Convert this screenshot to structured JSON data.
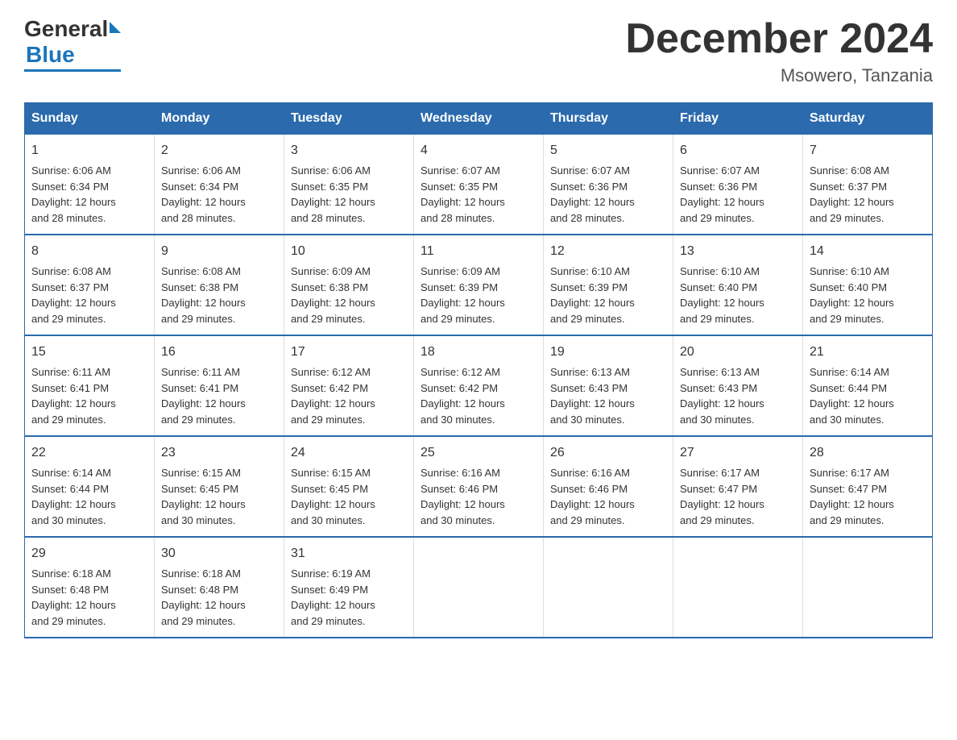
{
  "logo": {
    "general": "General",
    "blue": "Blue"
  },
  "title": "December 2024",
  "location": "Msowero, Tanzania",
  "days_of_week": [
    "Sunday",
    "Monday",
    "Tuesday",
    "Wednesday",
    "Thursday",
    "Friday",
    "Saturday"
  ],
  "weeks": [
    [
      {
        "day": "1",
        "sunrise": "6:06 AM",
        "sunset": "6:34 PM",
        "daylight": "12 hours and 28 minutes."
      },
      {
        "day": "2",
        "sunrise": "6:06 AM",
        "sunset": "6:34 PM",
        "daylight": "12 hours and 28 minutes."
      },
      {
        "day": "3",
        "sunrise": "6:06 AM",
        "sunset": "6:35 PM",
        "daylight": "12 hours and 28 minutes."
      },
      {
        "day": "4",
        "sunrise": "6:07 AM",
        "sunset": "6:35 PM",
        "daylight": "12 hours and 28 minutes."
      },
      {
        "day": "5",
        "sunrise": "6:07 AM",
        "sunset": "6:36 PM",
        "daylight": "12 hours and 28 minutes."
      },
      {
        "day": "6",
        "sunrise": "6:07 AM",
        "sunset": "6:36 PM",
        "daylight": "12 hours and 29 minutes."
      },
      {
        "day": "7",
        "sunrise": "6:08 AM",
        "sunset": "6:37 PM",
        "daylight": "12 hours and 29 minutes."
      }
    ],
    [
      {
        "day": "8",
        "sunrise": "6:08 AM",
        "sunset": "6:37 PM",
        "daylight": "12 hours and 29 minutes."
      },
      {
        "day": "9",
        "sunrise": "6:08 AM",
        "sunset": "6:38 PM",
        "daylight": "12 hours and 29 minutes."
      },
      {
        "day": "10",
        "sunrise": "6:09 AM",
        "sunset": "6:38 PM",
        "daylight": "12 hours and 29 minutes."
      },
      {
        "day": "11",
        "sunrise": "6:09 AM",
        "sunset": "6:39 PM",
        "daylight": "12 hours and 29 minutes."
      },
      {
        "day": "12",
        "sunrise": "6:10 AM",
        "sunset": "6:39 PM",
        "daylight": "12 hours and 29 minutes."
      },
      {
        "day": "13",
        "sunrise": "6:10 AM",
        "sunset": "6:40 PM",
        "daylight": "12 hours and 29 minutes."
      },
      {
        "day": "14",
        "sunrise": "6:10 AM",
        "sunset": "6:40 PM",
        "daylight": "12 hours and 29 minutes."
      }
    ],
    [
      {
        "day": "15",
        "sunrise": "6:11 AM",
        "sunset": "6:41 PM",
        "daylight": "12 hours and 29 minutes."
      },
      {
        "day": "16",
        "sunrise": "6:11 AM",
        "sunset": "6:41 PM",
        "daylight": "12 hours and 29 minutes."
      },
      {
        "day": "17",
        "sunrise": "6:12 AM",
        "sunset": "6:42 PM",
        "daylight": "12 hours and 29 minutes."
      },
      {
        "day": "18",
        "sunrise": "6:12 AM",
        "sunset": "6:42 PM",
        "daylight": "12 hours and 30 minutes."
      },
      {
        "day": "19",
        "sunrise": "6:13 AM",
        "sunset": "6:43 PM",
        "daylight": "12 hours and 30 minutes."
      },
      {
        "day": "20",
        "sunrise": "6:13 AM",
        "sunset": "6:43 PM",
        "daylight": "12 hours and 30 minutes."
      },
      {
        "day": "21",
        "sunrise": "6:14 AM",
        "sunset": "6:44 PM",
        "daylight": "12 hours and 30 minutes."
      }
    ],
    [
      {
        "day": "22",
        "sunrise": "6:14 AM",
        "sunset": "6:44 PM",
        "daylight": "12 hours and 30 minutes."
      },
      {
        "day": "23",
        "sunrise": "6:15 AM",
        "sunset": "6:45 PM",
        "daylight": "12 hours and 30 minutes."
      },
      {
        "day": "24",
        "sunrise": "6:15 AM",
        "sunset": "6:45 PM",
        "daylight": "12 hours and 30 minutes."
      },
      {
        "day": "25",
        "sunrise": "6:16 AM",
        "sunset": "6:46 PM",
        "daylight": "12 hours and 30 minutes."
      },
      {
        "day": "26",
        "sunrise": "6:16 AM",
        "sunset": "6:46 PM",
        "daylight": "12 hours and 29 minutes."
      },
      {
        "day": "27",
        "sunrise": "6:17 AM",
        "sunset": "6:47 PM",
        "daylight": "12 hours and 29 minutes."
      },
      {
        "day": "28",
        "sunrise": "6:17 AM",
        "sunset": "6:47 PM",
        "daylight": "12 hours and 29 minutes."
      }
    ],
    [
      {
        "day": "29",
        "sunrise": "6:18 AM",
        "sunset": "6:48 PM",
        "daylight": "12 hours and 29 minutes."
      },
      {
        "day": "30",
        "sunrise": "6:18 AM",
        "sunset": "6:48 PM",
        "daylight": "12 hours and 29 minutes."
      },
      {
        "day": "31",
        "sunrise": "6:19 AM",
        "sunset": "6:49 PM",
        "daylight": "12 hours and 29 minutes."
      },
      null,
      null,
      null,
      null
    ]
  ],
  "labels": {
    "sunrise": "Sunrise:",
    "sunset": "Sunset:",
    "daylight": "Daylight:"
  }
}
